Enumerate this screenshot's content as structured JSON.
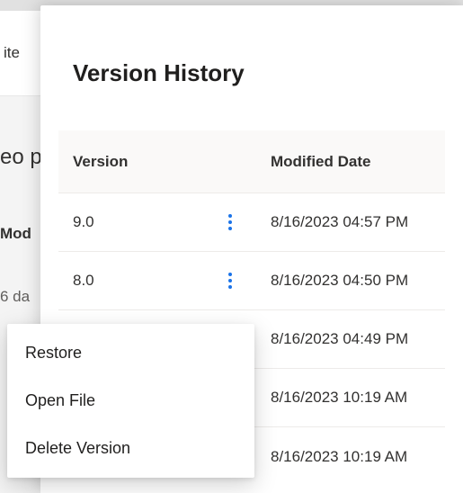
{
  "background": {
    "tab_fragment": "ite",
    "heading_fragment": "eo p",
    "label_fragment": "Mod",
    "meta_fragment": "6 da"
  },
  "panel": {
    "title": "Version History",
    "columns": {
      "version": "Version",
      "modified": "Modified Date"
    },
    "rows": [
      {
        "version": "9.0",
        "modified": "8/16/2023 04:57 PM"
      },
      {
        "version": "8.0",
        "modified": "8/16/2023 04:50 PM"
      },
      {
        "version": "",
        "modified": "8/16/2023 04:49 PM"
      },
      {
        "version": "",
        "modified": "8/16/2023 10:19 AM"
      },
      {
        "version": "",
        "modified": "8/16/2023 10:19 AM"
      }
    ]
  },
  "context_menu": {
    "items": [
      {
        "label": "Restore"
      },
      {
        "label": "Open File"
      },
      {
        "label": "Delete Version"
      }
    ]
  }
}
